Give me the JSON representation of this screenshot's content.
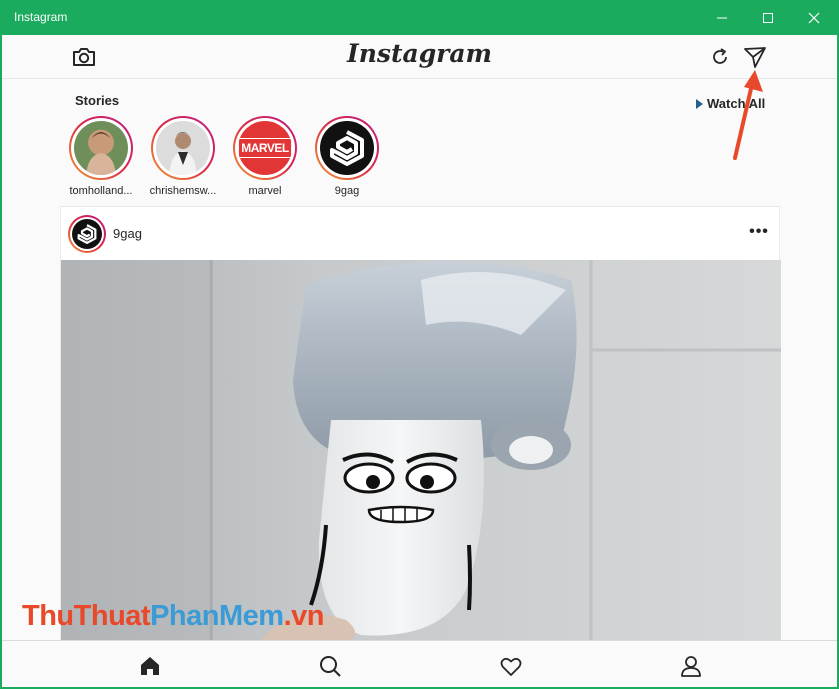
{
  "window": {
    "title": "Instagram"
  },
  "header": {
    "logo": "Instagram"
  },
  "stories": {
    "label": "Stories",
    "watch_all": "Watch All",
    "items": [
      {
        "name": "tomholland..."
      },
      {
        "name": "chrishemsw..."
      },
      {
        "name": "marvel",
        "badge": "MARVEL"
      },
      {
        "name": "9gag"
      }
    ]
  },
  "post": {
    "username": "9gag",
    "more": "•••"
  },
  "watermark": {
    "part1": "ThuThuat",
    "part2": "PhanMem",
    "part3": ".vn"
  },
  "colors": {
    "titlebar": "#1aab5e",
    "marvel_red": "#e23636",
    "arrow_red": "#e8492b"
  }
}
